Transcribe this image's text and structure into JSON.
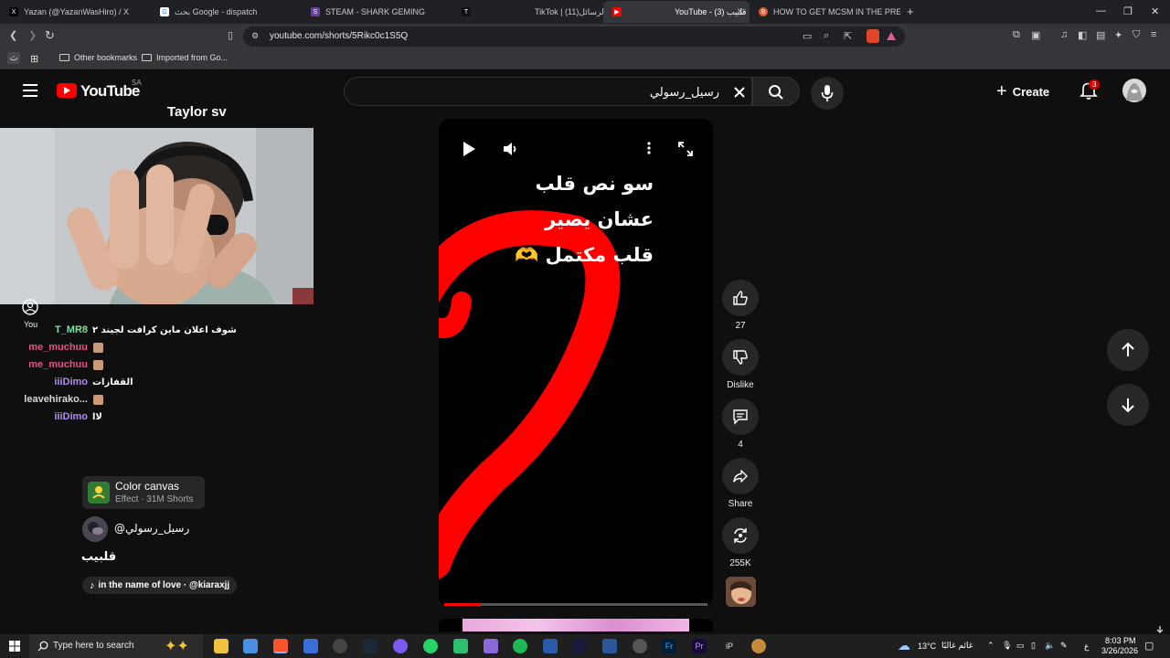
{
  "browser": {
    "tabs": [
      {
        "title": "Yazan (@YazanWasHiro) / X",
        "fav": "X"
      },
      {
        "title": "بحث Google - dispatch",
        "fav": "G"
      },
      {
        "title": "STEAM - SHARK GEMING",
        "fav": "S"
      },
      {
        "title": "",
        "fav": "T"
      },
      {
        "title": "TikTok | (11)الرسائل",
        "fav": ""
      },
      {
        "title": "YouTube - (3) قلبيب",
        "fav": "▶"
      },
      {
        "title": "HOW TO GET MCSM IN THE PRESEN",
        "fav": "B"
      }
    ],
    "new_tab": "+",
    "url": "youtube.com/shorts/5Rikc0c1S5Q",
    "bookmarks": {
      "apps_label": "ث",
      "other": "Other bookmarks",
      "imported": "Imported from Go..."
    }
  },
  "youtube": {
    "logo": "YouTube",
    "country": "SA",
    "search_value": "رسيل_رسولي",
    "create_label": "Create",
    "notification_count": "3"
  },
  "stream": {
    "overlay_title": "Taylor sv",
    "you_label": "You",
    "chat": [
      {
        "user": "T_MR8",
        "color": "#7fe0a0",
        "message": "شوف اعلان ماين كرافت لجيند ٢",
        "emote": false
      },
      {
        "user": "me_muchuu",
        "color": "#e8508a",
        "message": "",
        "emote": true
      },
      {
        "user": "me_muchuu",
        "color": "#e8508a",
        "message": "",
        "emote": true
      },
      {
        "user": "iiiDimo",
        "color": "#b08cf0",
        "message": "القفازات",
        "emote": false
      },
      {
        "user": "leavehirako...",
        "color": "#d8d8d8",
        "message": "",
        "emote": true
      },
      {
        "user": "iiiDimo",
        "color": "#b08cf0",
        "message": "لاا",
        "emote": false
      }
    ]
  },
  "short": {
    "caption_lines": [
      "سو نص قلب",
      "عشان يصير",
      "قلب مكتمل 🫶"
    ],
    "effect_title": "Color canvas",
    "effect_subtitle": "Effect · 31M Shorts",
    "channel": "@رسيل_رسولي",
    "title": "قلبيب",
    "music": "in the name of love · @kiaraxjj",
    "progress": 0.14,
    "likes": "27",
    "dislike_label": "Dislike",
    "comments": "4",
    "share_label": "Share",
    "remix": "255K"
  },
  "taskbar": {
    "search_placeholder": "Type here to search",
    "weather_temp": "13°C",
    "weather_desc": "غائم غالبًا",
    "lang": "ع",
    "time": "8:03 PM",
    "date": "3/26/2026"
  },
  "colors": {
    "accent": "#ff0000",
    "bg": "#0f0f0f",
    "heart_stroke": "#ff0000"
  }
}
